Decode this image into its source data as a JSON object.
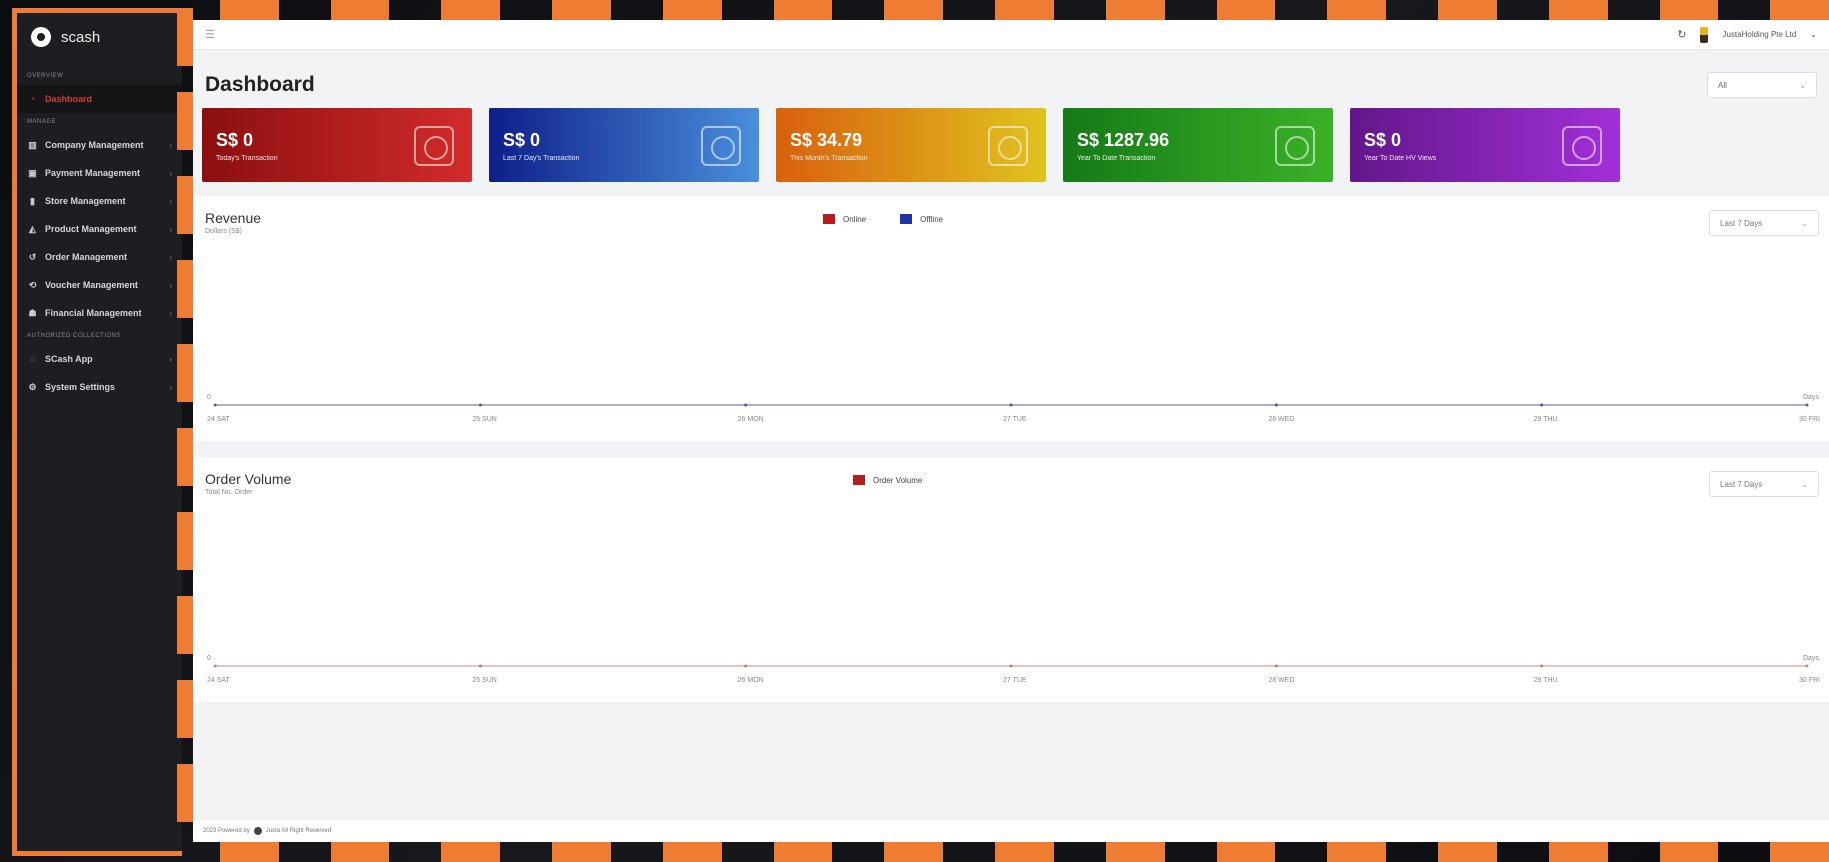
{
  "sidebar": {
    "brand": "scash",
    "sections": [
      "Overview",
      "Manage",
      "Authorized Collections"
    ],
    "items": [
      {
        "label": "Dashboard",
        "icon": "dashboard-icon",
        "active": true
      },
      {
        "label": "Company Management",
        "icon": "building-icon"
      },
      {
        "label": "Payment Management",
        "icon": "payment-icon"
      },
      {
        "label": "Store Management",
        "icon": "store-icon"
      },
      {
        "label": "Product Management",
        "icon": "product-icon"
      },
      {
        "label": "Order Management",
        "icon": "order-icon"
      },
      {
        "label": "Voucher Management",
        "icon": "voucher-icon"
      },
      {
        "label": "Financial Management",
        "icon": "finance-icon"
      },
      {
        "label": "SCash App",
        "icon": "app-icon"
      },
      {
        "label": "System Settings",
        "icon": "settings-icon"
      }
    ]
  },
  "topbar": {
    "company": "JustaHolding Pte Ltd"
  },
  "page": {
    "title": "Dashboard",
    "filter": "All"
  },
  "cards": [
    {
      "amount": "S$ 0",
      "caption": "Today's Transaction",
      "color": "#b81d1d"
    },
    {
      "amount": "S$ 0",
      "caption": "Last 7 Day's Transaction",
      "color": "#2447b0"
    },
    {
      "amount": "S$ 34.79",
      "caption": "This Month's Transaction",
      "color": "#dc8a17"
    },
    {
      "amount": "S$ 1287.96",
      "caption": "Year To Date Transaction",
      "color": "#249b20"
    },
    {
      "amount": "S$ 0",
      "caption": "Year To Date HV Views",
      "color": "#7f22b2"
    }
  ],
  "revenue": {
    "title": "Revenue",
    "subtitle": "Dollars (S$)",
    "range": "Last 7 Days",
    "legend": [
      {
        "name": "Online",
        "color": "#b81d1d"
      },
      {
        "name": "Offline",
        "color": "#1c34a8"
      }
    ]
  },
  "orders": {
    "title": "Order Volume",
    "subtitle": "Total No. Order",
    "range": "Last 7 Days",
    "legend": [
      {
        "name": "Order Volume",
        "color": "#b81d1d"
      }
    ]
  },
  "chart_data": [
    {
      "type": "line",
      "title": "Revenue",
      "ylabel": "Dollars (S$)",
      "xlabel": "Days",
      "categories": [
        "24 SAT",
        "25 SUN",
        "26 MON",
        "27 TUE",
        "28 WED",
        "29 THU",
        "30 FRI"
      ],
      "series": [
        {
          "name": "Online",
          "values": [
            0,
            0,
            0,
            0,
            0,
            0,
            0
          ]
        },
        {
          "name": "Offline",
          "values": [
            0,
            0,
            0,
            0,
            0,
            0,
            0
          ]
        }
      ],
      "y_tick": "0"
    },
    {
      "type": "line",
      "title": "Order Volume",
      "ylabel": "Total No. Order",
      "xlabel": "Days",
      "categories": [
        "24 SAT",
        "25 SUN",
        "26 MON",
        "27 TUE",
        "28 WED",
        "29 THU",
        "30 FRI"
      ],
      "series": [
        {
          "name": "Order Volume",
          "values": [
            0,
            0,
            0,
            0,
            0,
            0,
            0
          ]
        }
      ],
      "y_tick": "0"
    }
  ],
  "footer": {
    "text_left": "2023 Powered by",
    "text_right": "Justa All Right Reserved"
  }
}
